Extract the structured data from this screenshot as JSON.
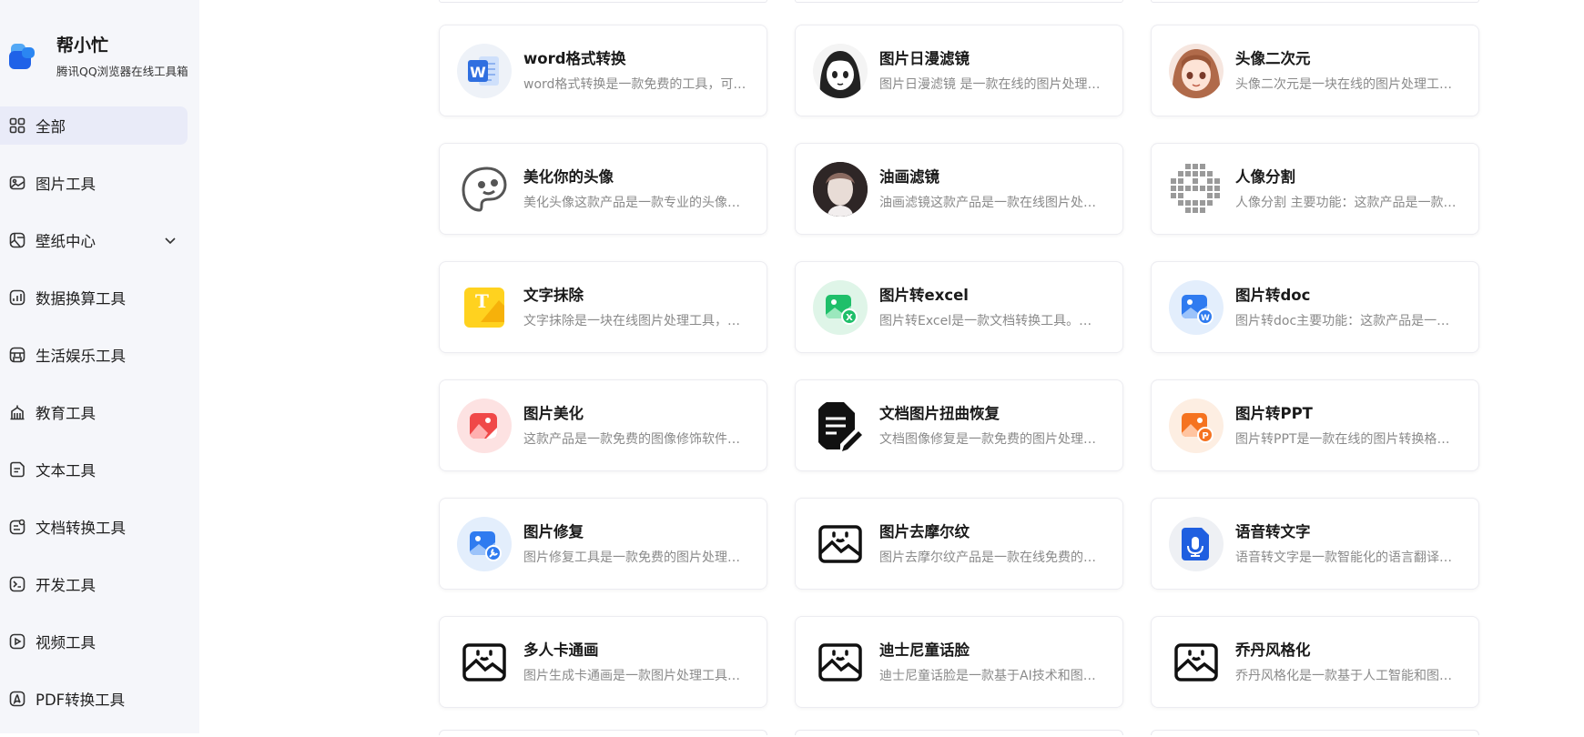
{
  "brand": {
    "name": "帮小忙",
    "subtitle": "腾讯QQ浏览器在线工具箱"
  },
  "sidebar": {
    "items": [
      {
        "label": "全部",
        "icon": "grid-icon",
        "active": true
      },
      {
        "label": "图片工具",
        "icon": "image-icon"
      },
      {
        "label": "壁纸中心",
        "icon": "wallpaper-icon",
        "expandable": true
      },
      {
        "label": "数据换算工具",
        "icon": "chart-icon"
      },
      {
        "label": "生活娱乐工具",
        "icon": "store-icon"
      },
      {
        "label": "教育工具",
        "icon": "education-icon"
      },
      {
        "label": "文本工具",
        "icon": "text-icon"
      },
      {
        "label": "文档转换工具",
        "icon": "doc-convert-icon"
      },
      {
        "label": "开发工具",
        "icon": "terminal-icon"
      },
      {
        "label": "视频工具",
        "icon": "video-icon"
      },
      {
        "label": "PDF转换工具",
        "icon": "pdf-icon"
      }
    ]
  },
  "tools": [
    {
      "title": "word格式转换",
      "desc": "word格式转换是一款免费的工具，可以帮助用户",
      "icon": "word-icon",
      "bg": "#eef2f8"
    },
    {
      "title": "图片日漫滤镜",
      "desc": "图片日漫滤镜 是一款在线的图片处理工具",
      "icon": "anime-portrait-icon",
      "bg": "#f4f4f4"
    },
    {
      "title": "头像二次元",
      "desc": "头像二次元是一块在线的图片处理工具，可以",
      "icon": "anime-avatar-icon",
      "bg": "#f6e6df"
    },
    {
      "title": "美化你的头像",
      "desc": "美化头像这款产品是一款专业的头像美化工具",
      "icon": "face-sketch-icon",
      "bg": "#ffffff"
    },
    {
      "title": "油画滤镜",
      "desc": "油画滤镜这款产品是一款在线图片处理工具",
      "icon": "oil-painting-icon",
      "bg": "#3a2f2f"
    },
    {
      "title": "人像分割",
      "desc": "人像分割 主要功能：这款产品是一款人像分割",
      "icon": "pixel-person-icon",
      "bg": "#ffffff"
    },
    {
      "title": "文字抹除",
      "desc": "文字抹除是一块在线图片处理工具，可以帮助",
      "icon": "text-erase-icon",
      "bg": "#ffffff"
    },
    {
      "title": "图片转excel",
      "desc": "图片转Excel是一款文档转换工具。它可以将",
      "icon": "image-to-excel-icon",
      "bg": "#dff5e8"
    },
    {
      "title": "图片转doc",
      "desc": "图片转doc主要功能：这款产品是一款图片转换",
      "icon": "image-to-doc-icon",
      "bg": "#e3eefc"
    },
    {
      "title": "图片美化",
      "desc": "这款产品是一款免费的图像修饰软件，可以帮助",
      "icon": "image-beautify-icon",
      "bg": "#fde2e2"
    },
    {
      "title": "文档图片扭曲恢复",
      "desc": "文档图像修复是一款免费的图片处理工具，可以",
      "icon": "doc-fix-icon",
      "bg": "#ffffff"
    },
    {
      "title": "图片转PPT",
      "desc": "图片转PPT是一款在线的图片转换格式工具",
      "icon": "image-to-ppt-icon",
      "bg": "#fdeee2"
    },
    {
      "title": "图片修复",
      "desc": "图片修复工具是一款免费的图片处理工具，可以",
      "icon": "image-repair-icon",
      "bg": "#e3eefc"
    },
    {
      "title": "图片去摩尔纹",
      "desc": "图片去摩尔纹产品是一款在线免费的图片处理",
      "icon": "smile-image-icon",
      "bg": "#ffffff"
    },
    {
      "title": "语音转文字",
      "desc": "语音转文字是一款智能化的语言翻译工具，可以",
      "icon": "voice-to-text-icon",
      "bg": "#eef0f4"
    },
    {
      "title": "多人卡通画",
      "desc": "图片生成卡通画是一款图片处理工具，可以帮助",
      "icon": "smile-image-icon",
      "bg": "#ffffff"
    },
    {
      "title": "迪士尼童话脸",
      "desc": "迪士尼童话脸是一款基于AI技术和图像处理的",
      "icon": "smile-image-icon",
      "bg": "#ffffff"
    },
    {
      "title": "乔丹风格化",
      "desc": "乔丹风格化是一款基于人工智能和图像处理的",
      "icon": "smile-image-icon",
      "bg": "#ffffff"
    }
  ]
}
